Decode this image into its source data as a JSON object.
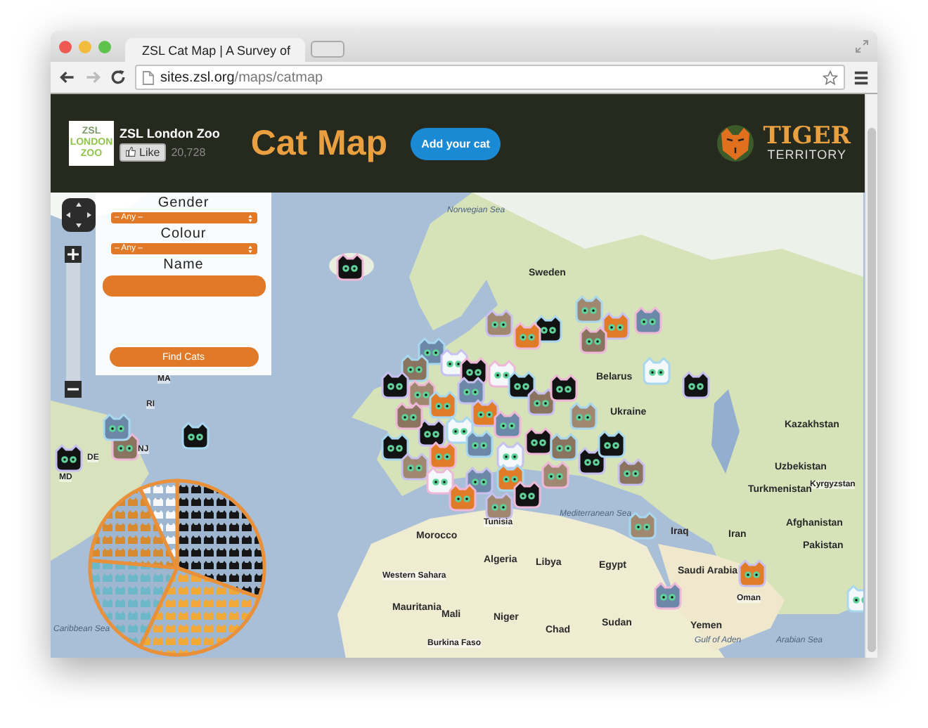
{
  "browser": {
    "tabs": [
      {
        "title": "ZSL Cat Map | A Survey of",
        "selected": true
      }
    ],
    "nav": [
      {
        "kind": "back",
        "disabled": false
      },
      {
        "kind": "forward",
        "disabled": true
      },
      {
        "kind": "reload",
        "disabled": false
      }
    ],
    "url": {
      "host": "sites.zsl.org",
      "path": "/maps/catmap"
    }
  },
  "header": {
    "logo_lines": [
      "ZSL",
      "LONDON",
      "ZOO"
    ],
    "org_name": "ZSL London Zoo",
    "like_button": "Like",
    "like_count": "20,728",
    "title": "Cat Map",
    "add_button": "Add your cat",
    "partner_logo": [
      "TIGER",
      "TERRITORY"
    ]
  },
  "filters": [
    {
      "label": "Gender",
      "kind": "select",
      "value": "– Any –"
    },
    {
      "label": "Colour",
      "kind": "select",
      "value": "– Any –"
    },
    {
      "label": "Name",
      "kind": "text"
    }
  ],
  "find_button": "Find Cats",
  "map": {
    "labels": [
      {
        "text": "Norwegian Sea",
        "kind": "sea"
      },
      {
        "text": "Sweden",
        "kind": "country"
      },
      {
        "text": "Belarus",
        "kind": "country"
      },
      {
        "text": "Ukraine",
        "kind": "country"
      },
      {
        "text": "Kazakhstan",
        "kind": "country"
      },
      {
        "text": "Uzbekistan",
        "kind": "country"
      },
      {
        "text": "Kyrgyzstan",
        "kind": "small"
      },
      {
        "text": "Turkmenistan",
        "kind": "country"
      },
      {
        "text": "Afghanistan",
        "kind": "country"
      },
      {
        "text": "Iraq",
        "kind": "country"
      },
      {
        "text": "Iran",
        "kind": "country"
      },
      {
        "text": "Pakistan",
        "kind": "country"
      },
      {
        "text": "Tunisia",
        "kind": "small"
      },
      {
        "text": "Mediterranean Sea",
        "kind": "sea"
      },
      {
        "text": "Morocco",
        "kind": "country"
      },
      {
        "text": "Algeria",
        "kind": "country"
      },
      {
        "text": "Western Sahara",
        "kind": "small"
      },
      {
        "text": "Mauritania",
        "kind": "country"
      },
      {
        "text": "Mali",
        "kind": "country"
      },
      {
        "text": "Burkina Faso",
        "kind": "small"
      },
      {
        "text": "Libya",
        "kind": "country"
      },
      {
        "text": "Egypt",
        "kind": "country"
      },
      {
        "text": "Niger",
        "kind": "country"
      },
      {
        "text": "Chad",
        "kind": "country"
      },
      {
        "text": "Sudan",
        "kind": "country"
      },
      {
        "text": "Saudi Arabia",
        "kind": "country"
      },
      {
        "text": "Oman",
        "kind": "small"
      },
      {
        "text": "Yemen",
        "kind": "country"
      },
      {
        "text": "Gulf of Aden",
        "kind": "sea"
      },
      {
        "text": "Arabian Sea",
        "kind": "sea"
      },
      {
        "text": "Caribbean Sea",
        "kind": "sea"
      },
      {
        "text": "MA",
        "kind": "small"
      },
      {
        "text": "RI",
        "kind": "small"
      },
      {
        "text": "NJ",
        "kind": "small"
      },
      {
        "text": "DE",
        "kind": "small"
      },
      {
        "text": "MD",
        "kind": "small"
      }
    ]
  }
}
